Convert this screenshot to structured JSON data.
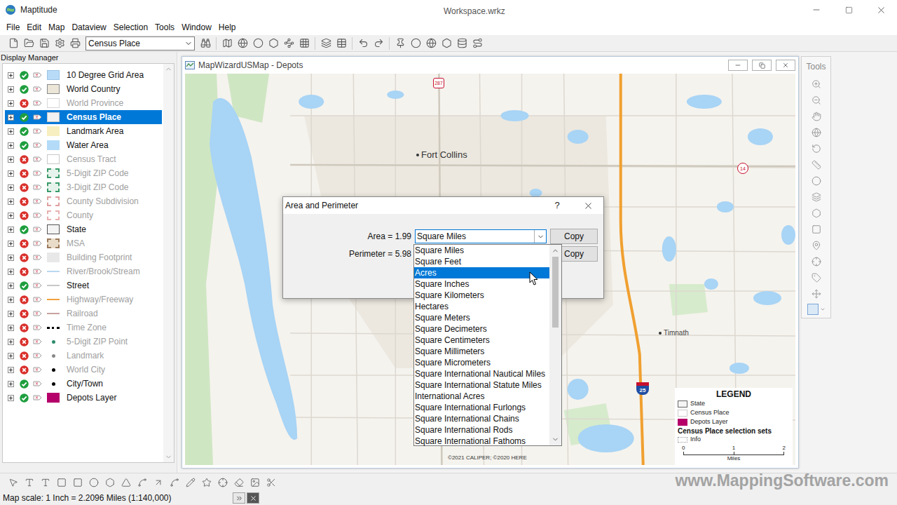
{
  "window": {
    "title": "Maptitude",
    "document": "Workspace.wrkz"
  },
  "menu": [
    "File",
    "Edit",
    "Map",
    "Dataview",
    "Selection",
    "Tools",
    "Window",
    "Help"
  ],
  "toolbar": {
    "layer_select": "Census Place"
  },
  "display_manager": {
    "title": "Display Manager",
    "layers": [
      {
        "name": "10 Degree Grid Area",
        "visible": true,
        "selected": false,
        "kind": "area",
        "color": "#b8dcf8",
        "border": "#9cc4e4"
      },
      {
        "name": "World Country",
        "visible": true,
        "selected": false,
        "kind": "area",
        "color": "#ece6d8",
        "border": "#8a8a8a"
      },
      {
        "name": "World Province",
        "visible": false,
        "selected": false,
        "kind": "area",
        "color": "#ffffff",
        "border": "#d8d8d8"
      },
      {
        "name": "Census Place",
        "visible": true,
        "selected": true,
        "kind": "area",
        "color": "#f2f2f2",
        "border": "#c8c8c8"
      },
      {
        "name": "Landmark Area",
        "visible": true,
        "selected": false,
        "kind": "area",
        "color": "#f7efc0",
        "border": "#f7efc0"
      },
      {
        "name": "Water Area",
        "visible": true,
        "selected": false,
        "kind": "area",
        "color": "#b3dbf7",
        "border": "#b3dbf7"
      },
      {
        "name": "Census Tract",
        "visible": false,
        "selected": false,
        "kind": "area",
        "color": "#ffffff",
        "border": "#c8c8c8"
      },
      {
        "name": "5-Digit ZIP Code",
        "visible": false,
        "selected": false,
        "kind": "dashed-area",
        "color": "#e6f3ec",
        "border": "#3a9a6a"
      },
      {
        "name": "3-Digit ZIP Code",
        "visible": false,
        "selected": false,
        "kind": "dashed-area",
        "color": "#e6f3ec",
        "border": "#3a9a6a"
      },
      {
        "name": "County Subdivision",
        "visible": false,
        "selected": false,
        "kind": "dashed-area",
        "color": "#ffffff",
        "border": "#e0a0a0"
      },
      {
        "name": "County",
        "visible": false,
        "selected": false,
        "kind": "dashed-area",
        "color": "#ffffff",
        "border": "#e8b0b0"
      },
      {
        "name": "State",
        "visible": true,
        "selected": false,
        "kind": "area",
        "color": "#f4f4f4",
        "border": "#555555"
      },
      {
        "name": "MSA",
        "visible": false,
        "selected": false,
        "kind": "dashed-area",
        "color": "#e8dcc8",
        "border": "#9a7a5a"
      },
      {
        "name": "Building Footprint",
        "visible": false,
        "selected": false,
        "kind": "area",
        "color": "#e8e8e8",
        "border": "#e8e8e8"
      },
      {
        "name": "River/Brook/Stream",
        "visible": false,
        "selected": false,
        "kind": "line",
        "color": "#b8d8f0",
        "border": "#b8d8f0"
      },
      {
        "name": "Street",
        "visible": true,
        "selected": false,
        "kind": "line",
        "color": "#c8c8c8",
        "border": "#c8c8c8"
      },
      {
        "name": "Highway/Freeway",
        "visible": false,
        "selected": false,
        "kind": "line",
        "color": "#f0a040",
        "border": "#f0a040"
      },
      {
        "name": "Railroad",
        "visible": false,
        "selected": false,
        "kind": "line",
        "color": "#c8a0a0",
        "border": "#c8a0a0"
      },
      {
        "name": "Time Zone",
        "visible": false,
        "selected": false,
        "kind": "dashed-line",
        "color": "#000000",
        "border": "#000000"
      },
      {
        "name": "5-Digit ZIP Point",
        "visible": false,
        "selected": false,
        "kind": "point",
        "color": "#2e8b6e",
        "border": "#2e8b6e"
      },
      {
        "name": "Landmark",
        "visible": false,
        "selected": false,
        "kind": "point",
        "color": "#888888",
        "border": "#888888"
      },
      {
        "name": "World City",
        "visible": false,
        "selected": false,
        "kind": "point",
        "color": "#000000",
        "border": "#000000"
      },
      {
        "name": "City/Town",
        "visible": true,
        "selected": false,
        "kind": "point",
        "color": "#000000",
        "border": "#000000"
      },
      {
        "name": "Depots Layer",
        "visible": true,
        "selected": false,
        "kind": "area",
        "color": "#b5006a",
        "border": "#b5006a"
      }
    ]
  },
  "map_window": {
    "title": "MapWizardUSMap - Depots",
    "labels": [
      {
        "text": "Fort Collins",
        "size": "large"
      },
      {
        "text": "Timnath",
        "size": "small"
      }
    ],
    "shields": [
      {
        "text": "287",
        "kind": "us"
      },
      {
        "text": "14",
        "kind": "state"
      },
      {
        "text": "25",
        "kind": "interstate"
      }
    ],
    "copyright": "©2021 CALIPER; ©2020 HERE",
    "legend": {
      "title": "LEGEND",
      "items": [
        {
          "label": "State",
          "color": "#f4f4f4",
          "border": "#666666"
        },
        {
          "label": "Census Place",
          "color": "#ffffff",
          "border": "#cccccc"
        },
        {
          "label": "Depots Layer",
          "color": "#b5006a",
          "border": "#b5006a"
        }
      ],
      "subtitle": "Census Place selection sets",
      "sets": [
        {
          "label": "Info"
        }
      ],
      "scale": {
        "ticks": [
          "0",
          "1",
          "2"
        ],
        "unit": "Miles"
      }
    }
  },
  "tools_palette": {
    "title": "Tools"
  },
  "dialog": {
    "title": "Area and Perimeter",
    "help": "?",
    "rows": [
      {
        "label": "Area = 1.99",
        "unit": "Square Miles",
        "button": "Copy",
        "focused": true
      },
      {
        "label": "Perimeter = 5.98",
        "unit": "",
        "button": "Copy",
        "focused": false
      }
    ],
    "unit_list": {
      "scroll_position": 0,
      "visible_share": 0.4,
      "items": [
        {
          "label": "Square Miles",
          "selected": false
        },
        {
          "label": "Square Feet",
          "selected": false
        },
        {
          "label": "Acres",
          "selected": true
        },
        {
          "label": "Square Inches",
          "selected": false
        },
        {
          "label": "Square Kilometers",
          "selected": false
        },
        {
          "label": "Hectares",
          "selected": false
        },
        {
          "label": "Square Meters",
          "selected": false
        },
        {
          "label": "Square Decimeters",
          "selected": false
        },
        {
          "label": "Square Centimeters",
          "selected": false
        },
        {
          "label": "Square Millimeters",
          "selected": false
        },
        {
          "label": "Square Micrometers",
          "selected": false
        },
        {
          "label": "Square International Nautical Miles",
          "selected": false
        },
        {
          "label": "Square International Statute Miles",
          "selected": false
        },
        {
          "label": "International Acres",
          "selected": false
        },
        {
          "label": "Square International Furlongs",
          "selected": false
        },
        {
          "label": "Square International Chains",
          "selected": false
        },
        {
          "label": "Square International Rods",
          "selected": false
        },
        {
          "label": "Square International Fathoms",
          "selected": false
        }
      ]
    }
  },
  "status_bar": {
    "text": "Map scale: 1 Inch = 2.2096 Miles (1:140,000)"
  },
  "watermark": "www.MappingSoftware.com"
}
